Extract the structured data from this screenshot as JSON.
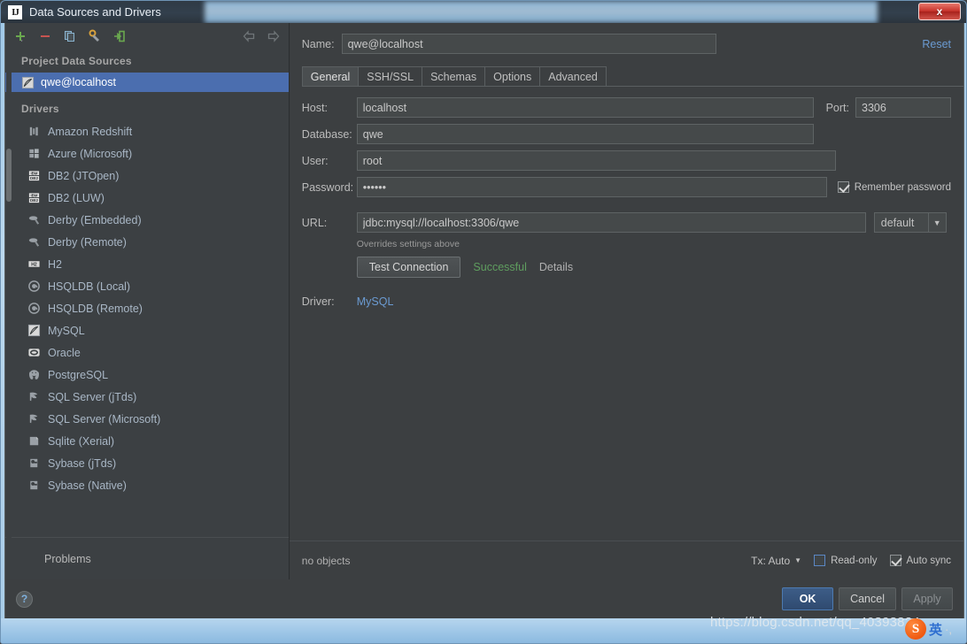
{
  "window": {
    "title": "Data Sources and Drivers",
    "app_icon": "intellij-idea-icon",
    "close_label": "x"
  },
  "left_panel": {
    "toolbar": [
      {
        "name": "add-button",
        "glyph": "+"
      },
      {
        "name": "remove-button",
        "glyph": "−"
      },
      {
        "name": "copy-button",
        "glyph": "copy-icon"
      },
      {
        "name": "settings-button",
        "glyph": "wrench-icon"
      },
      {
        "name": "import-button",
        "glyph": "import-icon"
      }
    ],
    "nav": [
      {
        "name": "nav-back-button",
        "glyph": "arrow-left-icon"
      },
      {
        "name": "nav-forward-button",
        "glyph": "arrow-right-icon"
      }
    ],
    "project_section_title": "Project Data Sources",
    "data_sources": [
      {
        "label": "qwe@localhost",
        "icon": "mysql-icon",
        "selected": true
      }
    ],
    "drivers_section_title": "Drivers",
    "drivers": [
      {
        "label": "Amazon Redshift",
        "icon": "redshift-icon"
      },
      {
        "label": "Azure (Microsoft)",
        "icon": "azure-icon"
      },
      {
        "label": "DB2 (JTOpen)",
        "icon": "db2-icon"
      },
      {
        "label": "DB2 (LUW)",
        "icon": "db2-icon"
      },
      {
        "label": "Derby (Embedded)",
        "icon": "derby-icon"
      },
      {
        "label": "Derby (Remote)",
        "icon": "derby-icon"
      },
      {
        "label": "H2",
        "icon": "h2-icon"
      },
      {
        "label": "HSQLDB (Local)",
        "icon": "hsqldb-icon"
      },
      {
        "label": "HSQLDB (Remote)",
        "icon": "hsqldb-icon"
      },
      {
        "label": "MySQL",
        "icon": "mysql-icon"
      },
      {
        "label": "Oracle",
        "icon": "oracle-icon"
      },
      {
        "label": "PostgreSQL",
        "icon": "postgres-icon"
      },
      {
        "label": "SQL Server (jTds)",
        "icon": "sqlserver-icon"
      },
      {
        "label": "SQL Server (Microsoft)",
        "icon": "sqlserver-icon"
      },
      {
        "label": "Sqlite (Xerial)",
        "icon": "sqlite-icon"
      },
      {
        "label": "Sybase (jTds)",
        "icon": "sybase-icon"
      },
      {
        "label": "Sybase (Native)",
        "icon": "sybase-icon"
      }
    ],
    "problems_label": "Problems"
  },
  "right_panel": {
    "name_label": "Name:",
    "name_value": "qwe@localhost",
    "reset_label": "Reset",
    "tabs": [
      {
        "label": "General",
        "active": true
      },
      {
        "label": "SSH/SSL",
        "active": false
      },
      {
        "label": "Schemas",
        "active": false
      },
      {
        "label": "Options",
        "active": false
      },
      {
        "label": "Advanced",
        "active": false
      }
    ],
    "fields": {
      "host_label": "Host:",
      "host_value": "localhost",
      "port_label": "Port:",
      "port_value": "3306",
      "database_label": "Database:",
      "database_value": "qwe",
      "user_label": "User:",
      "user_value": "root",
      "password_label": "Password:",
      "password_value": "••••••",
      "remember_password_label": "Remember password",
      "remember_password_checked": true,
      "url_label": "URL:",
      "url_value": "jdbc:mysql://localhost:3306/qwe",
      "url_dropdown_value": "default",
      "overrides_note": "Overrides settings above"
    },
    "test_connection_label": "Test Connection",
    "test_status": "Successful",
    "details_label": "Details",
    "driver_label": "Driver:",
    "driver_value": "MySQL",
    "status_bar": {
      "objects_text": "no objects",
      "tx_label": "Tx: Auto",
      "read_only_label": "Read-only",
      "read_only_checked": false,
      "auto_sync_label": "Auto sync",
      "auto_sync_checked": true
    }
  },
  "footer": {
    "help_label": "?",
    "ok_label": "OK",
    "cancel_label": "Cancel",
    "apply_label": "Apply"
  },
  "watermark": {
    "url": "https://blog.csdn.net/qq_40393824",
    "ime_logo": "S",
    "ime_lang": "英",
    "ime_dots": "·,"
  },
  "colors": {
    "accent_selection": "#4b6eaf",
    "link": "#6b9bd2",
    "success": "#5f9e5f",
    "panel_bg": "#3c3f41",
    "sidebar_bg": "#3c4043",
    "input_bg": "#45494a",
    "close_red": "#c6332b"
  }
}
